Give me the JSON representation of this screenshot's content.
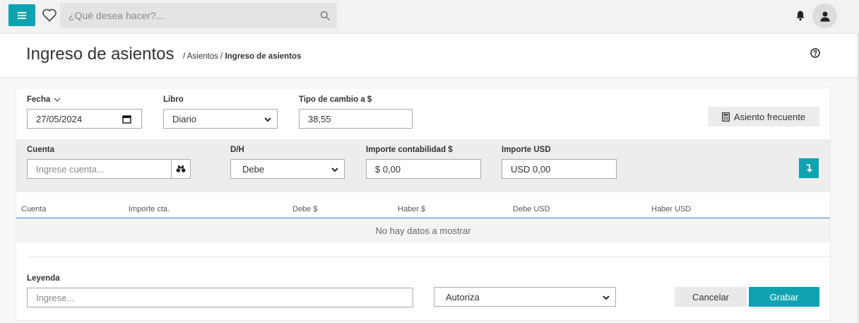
{
  "header": {
    "search_placeholder": "¿Qué desea hacer?..."
  },
  "page": {
    "title": "Ingreso de asientos",
    "breadcrumb_prefix": "/ Asientos / ",
    "breadcrumb_current": "Ingreso de asientos"
  },
  "form": {
    "fecha_label": "Fecha",
    "fecha_value": "27/05/2024",
    "libro_label": "Libro",
    "libro_value": "Diario",
    "tipo_cambio_label": "Tipo de cambio a $",
    "tipo_cambio_value": "38,55",
    "asiento_frecuente_label": "Asiento frecuente"
  },
  "entry": {
    "cuenta_label": "Cuenta",
    "cuenta_placeholder": "Ingrese cuenta...",
    "dh_label": "D/H",
    "dh_value": "Debe",
    "importe_contab_label": "Importe contabilidad $",
    "importe_contab_value": "$ 0,00",
    "importe_usd_label": "Importe USD",
    "importe_usd_value": "USD 0,00"
  },
  "table": {
    "columns": [
      "Cuenta",
      "Importe cta.",
      "Debe $",
      "Haber $",
      "Debe USD",
      "Haber USD"
    ],
    "empty_text": "No hay datos a mostrar"
  },
  "footer": {
    "leyenda_label": "Leyenda",
    "leyenda_placeholder": "Ingrese...",
    "autoriza_value": "Autoriza",
    "cancel_label": "Cancelar",
    "save_label": "Grabar"
  },
  "colors": {
    "accent": "#0fa3b1",
    "table_header_line": "#3b7dd8"
  },
  "icons": {
    "menu": "menu-icon",
    "favorites": "heart-icon",
    "search": "search-icon",
    "notifications": "bell-icon",
    "user": "user-icon",
    "help": "help-icon",
    "calendar": "calendar-icon",
    "lookup": "binoculars-icon",
    "calculator": "calculator-icon",
    "insert": "arrow-down-icon"
  }
}
